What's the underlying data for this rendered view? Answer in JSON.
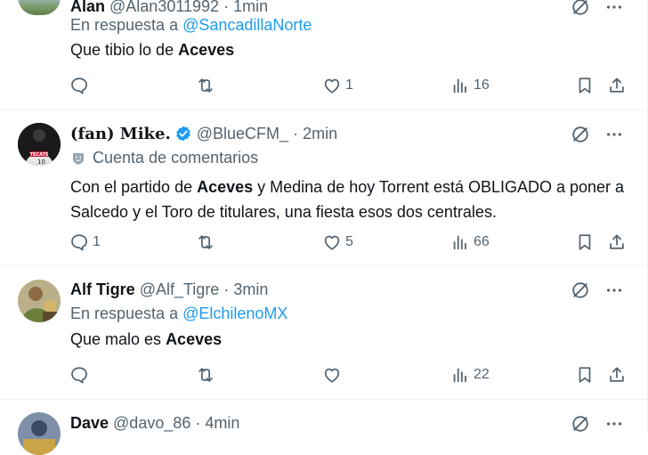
{
  "tweets": [
    {
      "name": "Alan",
      "handle": "@Alan3011992",
      "time": "1min",
      "reply_prefix": "En respuesta a",
      "reply_to": "@SancadillaNorte",
      "text_pre": "Que tibio lo de ",
      "text_bold": "Aceves",
      "text_post": "",
      "replies": "",
      "retweets": "",
      "likes": "1",
      "views": "16"
    },
    {
      "name": "(fan) Mike.",
      "handle": "@BlueCFM_",
      "time": "2min",
      "label": "Cuenta de comentarios",
      "text_pre": "Con el partido de ",
      "text_bold": "Aceves",
      "text_post": " y Medina de hoy Torrent está OBLIGADO a poner a Salcedo y el Toro de titulares, una fiesta esos dos centrales.",
      "replies": "1",
      "retweets": "",
      "likes": "5",
      "views": "66"
    },
    {
      "name": "Alf Tigre",
      "handle": "@Alf_Tigre",
      "time": "3min",
      "reply_prefix": "En respuesta a",
      "reply_to": "@ElchilenoMX",
      "text_pre": "Que malo es ",
      "text_bold": "Aceves",
      "text_post": "",
      "replies": "",
      "retweets": "",
      "likes": "",
      "views": "22"
    },
    {
      "name": "Dave",
      "handle": "@davo_86",
      "time": "4min"
    }
  ],
  "dot": "·",
  "colors": {
    "link": "#1d9bf0",
    "muted": "#536471",
    "text": "#0f1419",
    "verified": "#1d9bf0"
  },
  "icons": [
    "reply-icon",
    "retweet-icon",
    "like-icon",
    "views-icon",
    "bookmark-icon",
    "share-icon",
    "grok-icon",
    "more-icon",
    "verified-badge-icon",
    "comment-account-icon"
  ]
}
